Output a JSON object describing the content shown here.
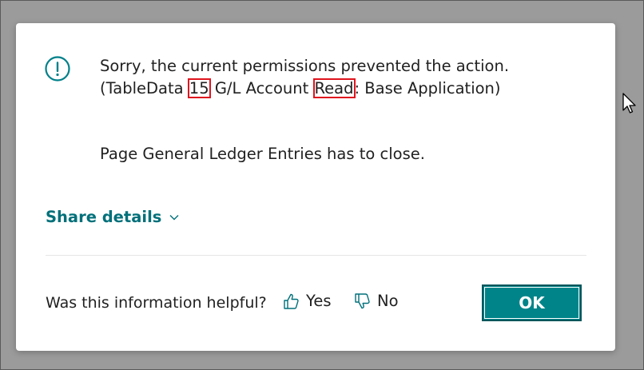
{
  "dialog": {
    "icon": "exclamation-circle-icon",
    "message": {
      "part1": "Sorry, the current permissions prevented the action. (TableData ",
      "table_id": "15",
      "part2": " G/L Account ",
      "permission": "Read",
      "part3": ": Base Application)"
    },
    "close_message": "Page General Ledger Entries has to close.",
    "share_details_label": "Share details",
    "feedback": {
      "question": "Was this information helpful?",
      "yes_label": "Yes",
      "no_label": "No"
    },
    "ok_label": "OK"
  },
  "colors": {
    "accent": "#008489",
    "link": "#00707a",
    "highlight_box": "#e0141e"
  }
}
